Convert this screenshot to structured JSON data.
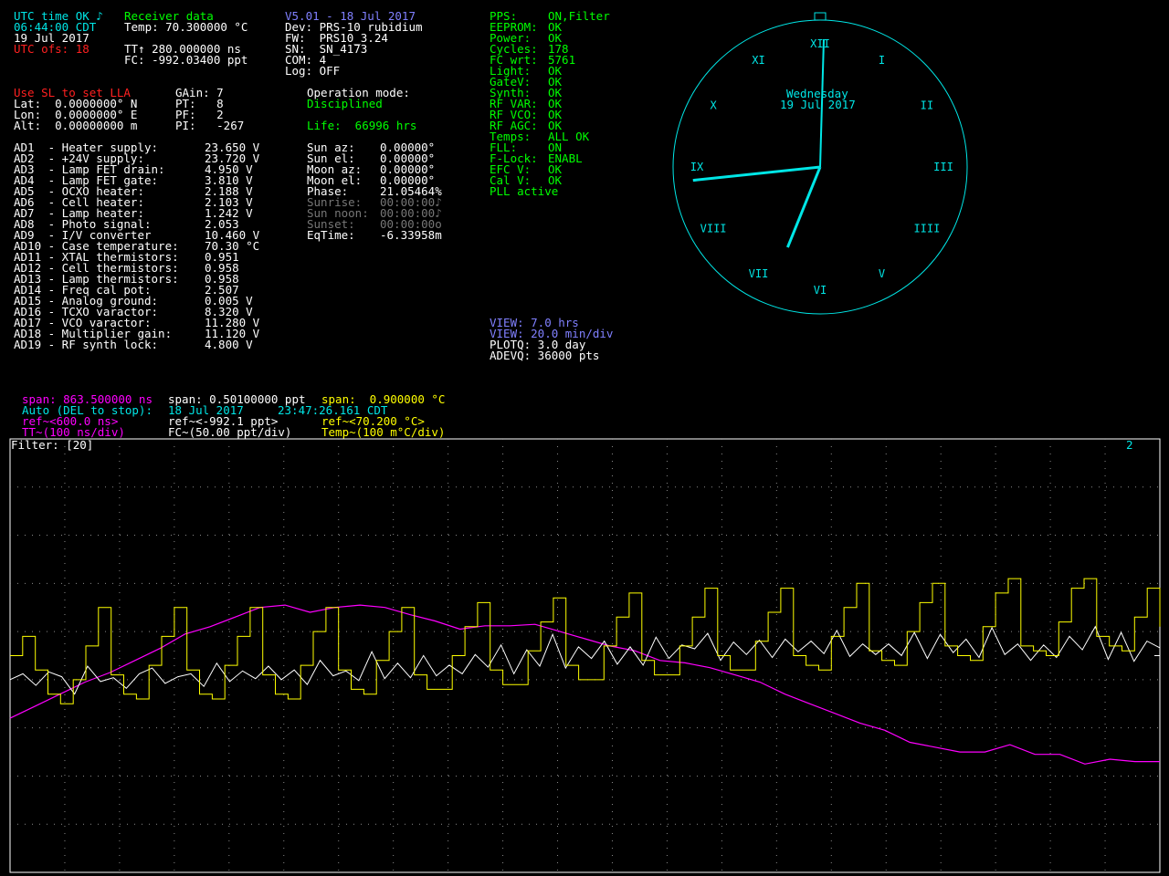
{
  "colors": {
    "white": "#ffffff",
    "cyan": "#00e6e6",
    "yellow": "#ffff00",
    "red": "#ff2020",
    "green": "#00ff00",
    "blue": "#8080ff",
    "magenta": "#ff00ff",
    "grid": "#777777"
  },
  "time": {
    "status": "UTC time OK ♪",
    "clock": "06:44:00 CDT",
    "date": "19 Jul 2017",
    "utc_ofs": "UTC ofs: 18"
  },
  "receiver": {
    "title": "Receiver data",
    "temp": "Temp: 70.300000 °C",
    "tt": "TT↑ 280.000000 ns",
    "fc": "FC: -992.03400 ppt"
  },
  "device": {
    "version": "V5.01 - 18 Jul 2017",
    "dev": "Dev: PRS-10 rubidium",
    "fw": "FW:  PRS10_3.24",
    "sn": "SN:  SN_4173",
    "com": "COM: 4",
    "log": "Log: OFF"
  },
  "status": [
    {
      "l": "PPS:",
      "v": "ON,Filter"
    },
    {
      "l": "EEPROM:",
      "v": "OK"
    },
    {
      "l": "Power:",
      "v": "OK"
    },
    {
      "l": "Cycles:",
      "v": "178"
    },
    {
      "l": "FC wrt:",
      "v": "5761"
    },
    {
      "l": "Light:",
      "v": "OK"
    },
    {
      "l": "GateV:",
      "v": "OK"
    },
    {
      "l": "Synth:",
      "v": "OK"
    },
    {
      "l": "RF VAR:",
      "v": "OK"
    },
    {
      "l": "RF VCO:",
      "v": "OK"
    },
    {
      "l": "RF AGC:",
      "v": "OK"
    },
    {
      "l": "Temps:",
      "v": "ALL OK"
    },
    {
      "l": "FLL:",
      "v": "ON"
    },
    {
      "l": "F-Lock:",
      "v": "ENABL"
    },
    {
      "l": "EFC V:",
      "v": "OK"
    },
    {
      "l": "Cal V:",
      "v": "OK"
    },
    {
      "l": "",
      "v": "PLL active"
    }
  ],
  "position": {
    "hint": "Use SL to set LLA",
    "lat": "Lat:  0.0000000° N",
    "lon": "Lon:  0.0000000° E",
    "alt": "Alt:  0.00000000 m"
  },
  "pid": {
    "gain": "GAin: 7",
    "pt": "PT:   8",
    "pf": "PF:   2",
    "pi": "PI:   -267"
  },
  "operation": {
    "label": "Operation mode:",
    "mode": "Disciplined",
    "life": "Life:  66996 hrs"
  },
  "ad": [
    {
      "n": "AD1  - Heater supply:",
      "v": "23.650 V"
    },
    {
      "n": "AD2  - +24V supply:",
      "v": "23.720 V"
    },
    {
      "n": "AD3  - Lamp FET drain:",
      "v": "4.950 V"
    },
    {
      "n": "AD4  - Lamp FET gate:",
      "v": "3.810 V"
    },
    {
      "n": "AD5  - OCXO heater:",
      "v": "2.188 V"
    },
    {
      "n": "AD6  - Cell heater:",
      "v": "2.103 V"
    },
    {
      "n": "AD7  - Lamp heater:",
      "v": "1.242 V"
    },
    {
      "n": "AD8  - Photo signal:",
      "v": "2.053"
    },
    {
      "n": "AD9  - I/V converter",
      "v": "10.460 V"
    },
    {
      "n": "AD10 - Case temperature:",
      "v": "70.30 °C"
    },
    {
      "n": "AD11 - XTAL thermistors:",
      "v": "0.951"
    },
    {
      "n": "AD12 - Cell thermistors:",
      "v": "0.958"
    },
    {
      "n": "AD13 - Lamp thermistors:",
      "v": "0.958"
    },
    {
      "n": "AD14 - Freq cal pot:",
      "v": "2.507"
    },
    {
      "n": "AD15 - Analog ground:",
      "v": "0.005 V"
    },
    {
      "n": "AD16 - TCXO varactor:",
      "v": "8.320 V"
    },
    {
      "n": "AD17 - VCO varactor:",
      "v": "11.280 V"
    },
    {
      "n": "AD18 - Multiplier gain:",
      "v": "11.120 V"
    },
    {
      "n": "AD19 - RF synth lock:",
      "v": "4.800 V"
    }
  ],
  "astro": [
    {
      "n": "Sun az:",
      "v": "0.00000°",
      "dim": false
    },
    {
      "n": "Sun el:",
      "v": "0.00000°",
      "dim": false
    },
    {
      "n": "Moon az:",
      "v": "0.00000°",
      "dim": false
    },
    {
      "n": "Moon el:",
      "v": "0.00000°",
      "dim": false
    },
    {
      "n": "Phase:",
      "v": "21.05464%",
      "dim": false
    },
    {
      "n": "Sunrise:",
      "v": "00:00:00♪",
      "dim": true
    },
    {
      "n": "Sun noon:",
      "v": "00:00:00♪",
      "dim": true
    },
    {
      "n": "Sunset:",
      "v": "00:00:00o",
      "dim": true
    },
    {
      "n": "EqTime:",
      "v": "-6.33958m",
      "dim": false
    }
  ],
  "clock": {
    "day": "Wednesday",
    "date": "19 Jul 2017",
    "hour": 6,
    "minute": 44,
    "numerals": [
      "XII",
      "I",
      "II",
      "III",
      "IIII",
      "V",
      "VI",
      "VII",
      "VIII",
      "IX",
      "X",
      "XI"
    ]
  },
  "view": {
    "v1": "VIEW: 7.0 hrs",
    "v2": "VIEW: 20.0 min/div",
    "plotq": "PLOTQ: 3.0 day",
    "adevq": "ADEVQ: 36000 pts"
  },
  "plot_header": {
    "span_tt": "span: 863.500000 ns",
    "span_fc": "span: 0.50100000 ppt",
    "span_temp": "span:  0.900000 °C",
    "auto": "Auto (DEL to stop):",
    "start_date": "18 Jul 2017",
    "start_time": "23:47:26.161 CDT",
    "ref_tt": "ref~<600.0 ns>",
    "ref_fc": "ref~<-992.1 ppt>",
    "ref_temp": "ref~<70.200 °C>",
    "scale_tt": "TT~(100 ns/div)",
    "scale_fc": "FC~(50.00 ppt/div)",
    "scale_temp": "Temp~(100 m°C/div)",
    "filter": "Filter: [20]",
    "marker": "2"
  },
  "chart_data": {
    "type": "line",
    "x_unit": "min",
    "x_divisions": 21,
    "y_divisions": 9,
    "series": [
      {
        "name": "TT",
        "color": "#ff00ff",
        "scale": "100 ns/div",
        "ref": "600.0 ns",
        "values": [
          470,
          495,
          520,
          545,
          565,
          590,
          615,
          645,
          660,
          680,
          700,
          705,
          690,
          700,
          705,
          700,
          685,
          672,
          655,
          662,
          662,
          665,
          650,
          635,
          620,
          610,
          590,
          585,
          575,
          560,
          545,
          520,
          500,
          480,
          460,
          445,
          420,
          410,
          400,
          400,
          415,
          395,
          395,
          375,
          385,
          380,
          380
        ]
      },
      {
        "name": "FC",
        "color": "#ffffff",
        "scale": "50.00 ppt/div",
        "ref": "-992.1 ppt",
        "values": [
          -1017,
          -1011,
          -1023,
          -1009,
          -1014,
          -1032,
          -1003,
          -1019,
          -1015,
          -1026,
          -1011,
          -1005,
          -1021,
          -1014,
          -1011,
          -1024,
          -1000,
          -1019,
          -1008,
          -1016,
          -1003,
          -1017,
          -1007,
          -1022,
          -997,
          -1013,
          -1008,
          -1018,
          -988,
          -1016,
          -1000,
          -1015,
          -992,
          -1013,
          -1002,
          -1011,
          -991,
          -1004,
          -981,
          -1011,
          -986,
          -1003,
          -970,
          -1005,
          -983,
          -995,
          -977,
          -1001,
          -983,
          -1002,
          -973,
          -995,
          -981,
          -985,
          -969,
          -997,
          -978,
          -991,
          -976,
          -994,
          -975,
          -988,
          -977,
          -990,
          -966,
          -993,
          -980,
          -991,
          -980,
          -992,
          -968,
          -995,
          -970,
          -989,
          -975,
          -994,
          -963,
          -991,
          -980,
          -997,
          -981,
          -994,
          -972,
          -986,
          -962,
          -996,
          -968,
          -998,
          -977,
          -984
        ]
      },
      {
        "name": "Temp",
        "color": "#ffff00",
        "scale": "100 m°C/div",
        "ref": "70.200 °C",
        "values": [
          70.2,
          70.24,
          70.17,
          70.12,
          70.1,
          70.15,
          70.22,
          70.3,
          70.16,
          70.12,
          70.11,
          70.18,
          70.24,
          70.3,
          70.17,
          70.12,
          70.11,
          70.18,
          70.24,
          70.3,
          70.16,
          70.12,
          70.11,
          70.18,
          70.25,
          70.3,
          70.17,
          70.13,
          70.12,
          70.19,
          70.25,
          70.3,
          70.16,
          70.13,
          70.13,
          70.2,
          70.26,
          70.31,
          70.17,
          70.14,
          70.14,
          70.21,
          70.27,
          70.32,
          70.18,
          70.15,
          70.15,
          70.22,
          70.28,
          70.33,
          70.19,
          70.16,
          70.16,
          70.22,
          70.28,
          70.34,
          70.2,
          70.17,
          70.17,
          70.23,
          70.29,
          70.34,
          70.2,
          70.18,
          70.17,
          70.24,
          70.3,
          70.35,
          70.21,
          70.19,
          70.18,
          70.25,
          70.31,
          70.35,
          70.22,
          70.2,
          70.19,
          70.26,
          70.33,
          70.36,
          70.22,
          70.21,
          70.2,
          70.27,
          70.34,
          70.36,
          70.24,
          70.22,
          70.21,
          70.28,
          70.34,
          70.26
        ]
      }
    ]
  }
}
